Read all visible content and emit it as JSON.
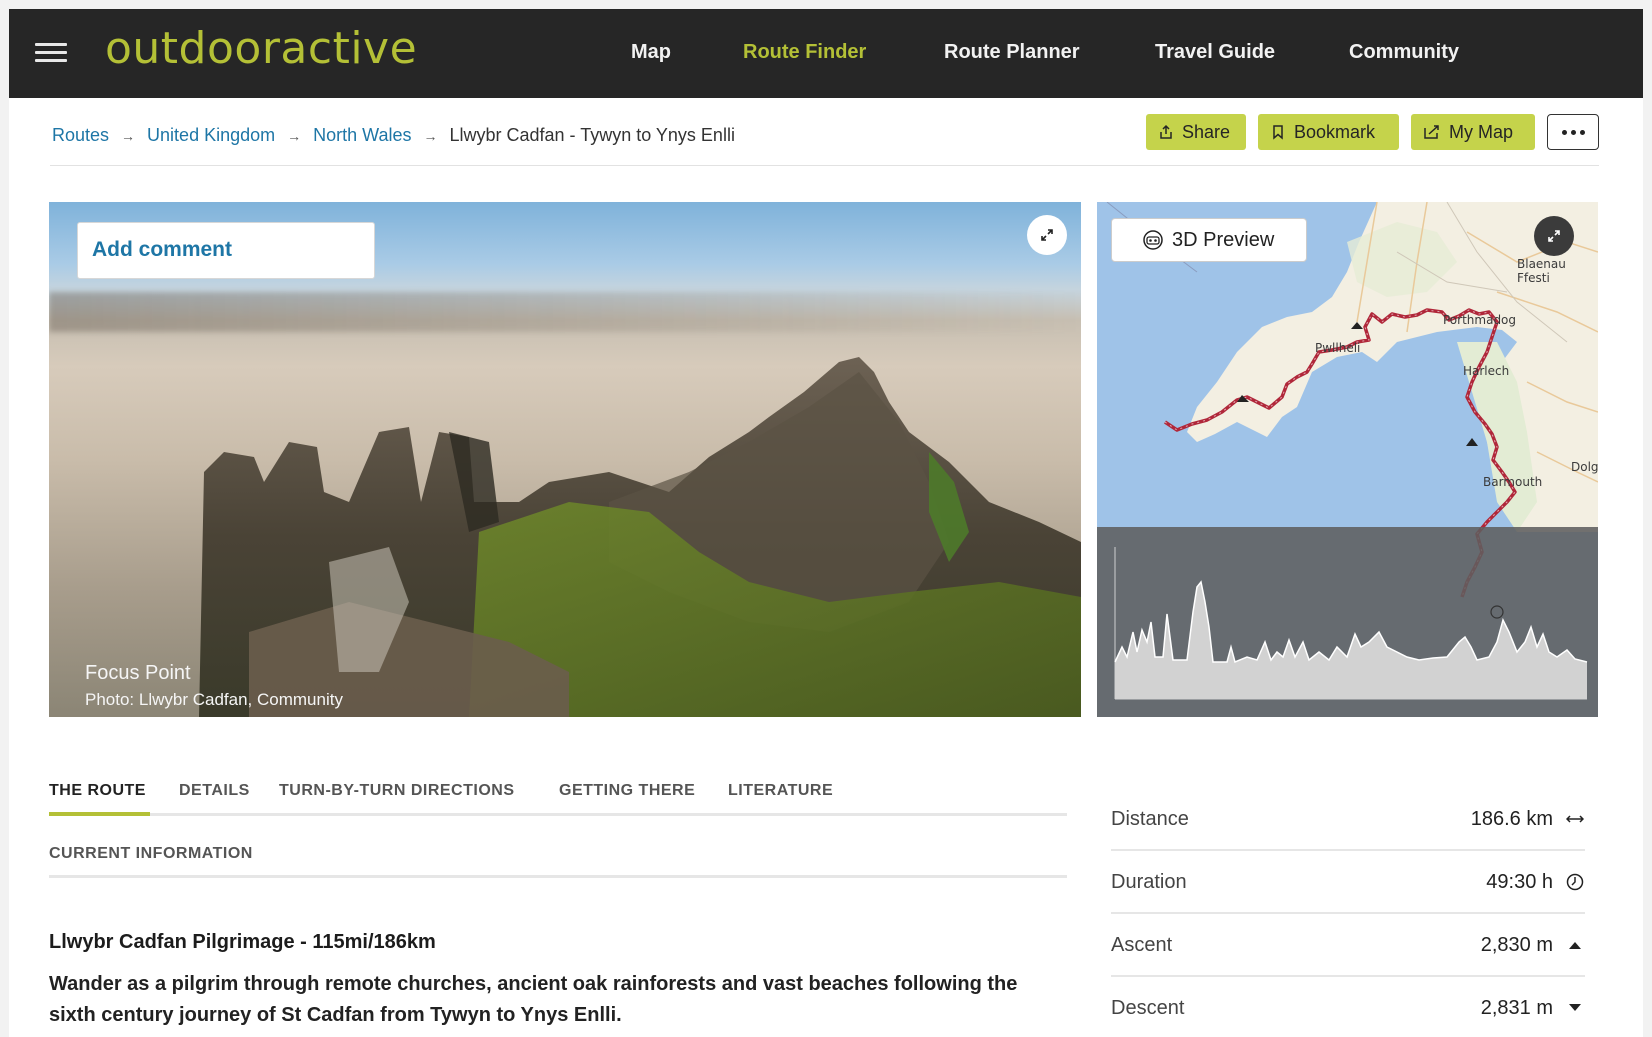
{
  "header": {
    "logo": "outdooractive",
    "nav": [
      "Map",
      "Route Finder",
      "Route Planner",
      "Travel Guide",
      "Community"
    ],
    "active_nav": "Route Finder"
  },
  "breadcrumb": {
    "items": [
      "Routes",
      "United Kingdom",
      "North Wales"
    ],
    "current": "Llwybr Cadfan - Tywyn to Ynys Enlli"
  },
  "actions": {
    "share": "Share",
    "bookmark": "Bookmark",
    "my_map": "My Map"
  },
  "photo": {
    "add_comment": "Add comment",
    "title": "Focus Point",
    "credit": "Photo: Llwybr Cadfan, Community"
  },
  "map": {
    "preview_label": "3D Preview",
    "places": [
      "Blaenau Ffesti",
      "Porthmadog",
      "Pwllheli",
      "Harlech",
      "Dolg",
      "Barmouth"
    ]
  },
  "tabs": [
    "THE ROUTE",
    "DETAILS",
    "TURN-BY-TURN DIRECTIONS",
    "GETTING THERE",
    "LITERATURE"
  ],
  "active_tab": "THE ROUTE",
  "subtab": "CURRENT INFORMATION",
  "article": {
    "heading": "Llwybr Cadfan Pilgrimage - 115mi/186km",
    "description": "Wander as a pilgrim through remote churches, ancient oak rainforests and vast beaches following the sixth century journey of St Cadfan from Tywyn to Ynys Enlli."
  },
  "stats": [
    {
      "label": "Distance",
      "value": "186.6 km",
      "icon": "distance-icon"
    },
    {
      "label": "Duration",
      "value": "49:30 h",
      "icon": "clock-icon"
    },
    {
      "label": "Ascent",
      "value": "2,830 m",
      "icon": "ascent-arrow-icon"
    },
    {
      "label": "Descent",
      "value": "2,831 m",
      "icon": "descent-arrow-icon"
    }
  ],
  "colors": {
    "brand": "#b4c036",
    "button": "#c5d34b",
    "link": "#1e76a6",
    "header": "#262626",
    "route": "#b0273a"
  }
}
